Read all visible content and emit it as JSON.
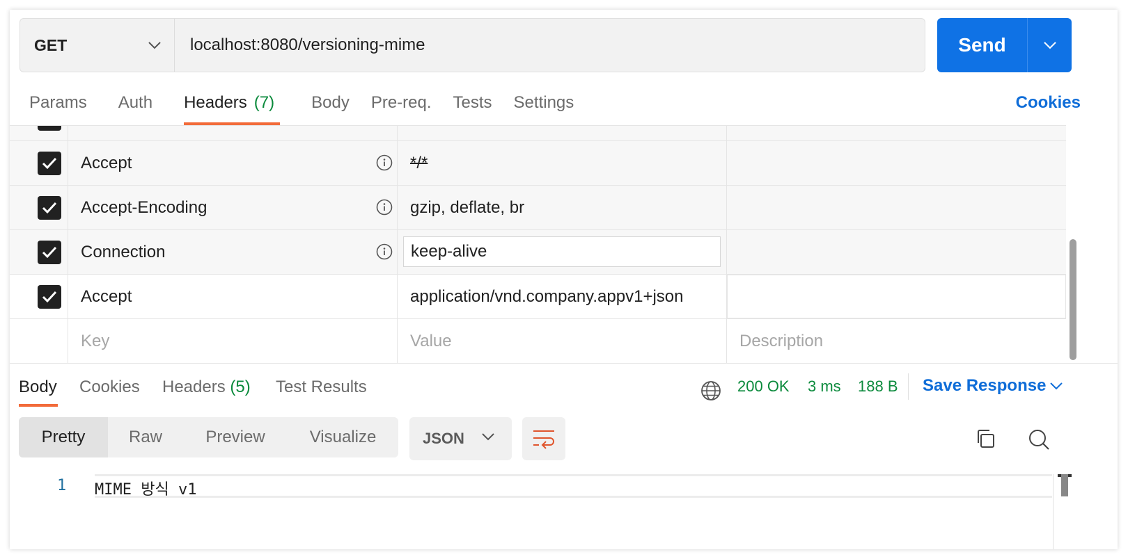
{
  "request": {
    "method": "GET",
    "url": "localhost:8080/versioning-mime",
    "send_label": "Send"
  },
  "request_tabs": [
    {
      "label": "Params"
    },
    {
      "label": "Auth"
    },
    {
      "label": "Headers",
      "count": "(7)"
    },
    {
      "label": "Body"
    },
    {
      "label": "Pre-req."
    },
    {
      "label": "Tests"
    },
    {
      "label": "Settings"
    }
  ],
  "cookies_link": "Cookies",
  "headers_table": {
    "rows": [
      {
        "key": "Accept",
        "value": "*/*"
      },
      {
        "key": "Accept-Encoding",
        "value": "gzip, deflate, br"
      },
      {
        "key": "Connection",
        "value": "keep-alive"
      },
      {
        "key": "Accept",
        "value": "application/vnd.company.appv1+json"
      }
    ],
    "placeholders": {
      "key": "Key",
      "value": "Value",
      "description": "Description"
    }
  },
  "response_tabs": [
    {
      "label": "Body"
    },
    {
      "label": "Cookies"
    },
    {
      "label": "Headers",
      "count": "(5)"
    },
    {
      "label": "Test Results"
    }
  ],
  "response_status": {
    "status": "200 OK",
    "time": "3 ms",
    "size": "188 B",
    "save_label": "Save Response"
  },
  "view_modes": [
    "Pretty",
    "Raw",
    "Preview",
    "Visualize"
  ],
  "format": "JSON",
  "code": {
    "line_number": "1",
    "line_text": "MIME 방식 v1"
  },
  "colors": {
    "accent_blue": "#0f72e5",
    "tab_underline": "#f26b3a",
    "success_green": "#0b8a3c"
  },
  "icons": [
    "chevron-down-icon",
    "info-icon",
    "check-icon",
    "globe-icon",
    "wrap-lines-icon",
    "copy-icon",
    "search-icon"
  ]
}
